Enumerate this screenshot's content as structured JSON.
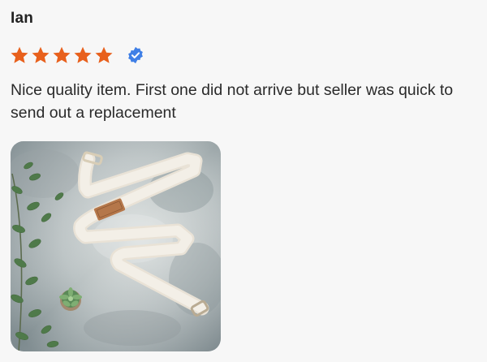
{
  "review": {
    "reviewer_name": "Ian",
    "rating": 5,
    "rating_max": 5,
    "star_color": "#e8601c",
    "verified_color": "#3f7fe6",
    "verified_icon": "verified-check-badge-icon",
    "text": "Nice quality item. First one did not arrive but seller was quick to send out a replacement",
    "photo": {
      "icon": "review-photo-yoga-strap",
      "background_color": "#a7b2b4"
    }
  }
}
